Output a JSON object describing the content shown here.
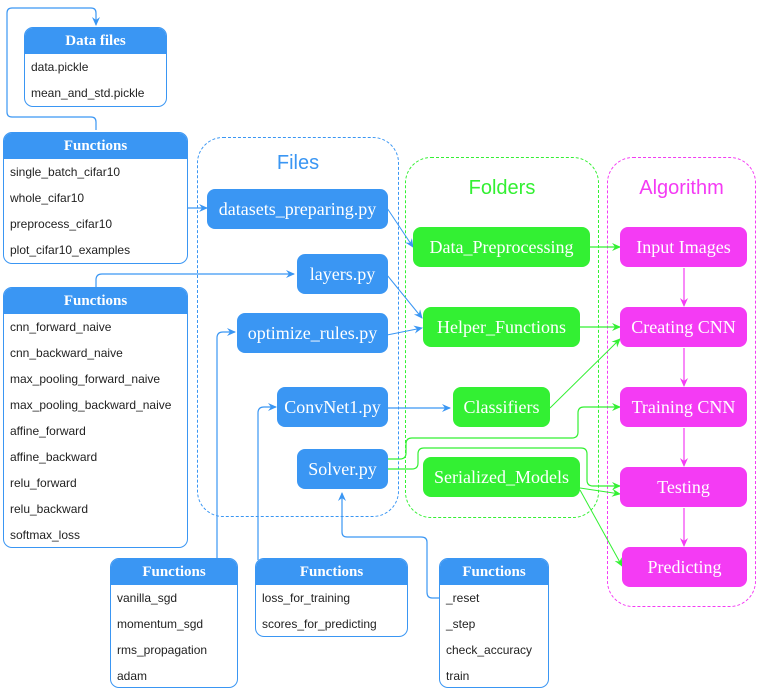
{
  "colors": {
    "files_blue": "#3a96f3",
    "folders_green": "#33f033",
    "algorithm_pink": "#f43bf4"
  },
  "data_files": {
    "title": "Data files",
    "items": [
      "data.pickle",
      "mean_and_std.pickle"
    ]
  },
  "functions_preparing": {
    "title": "Functions",
    "items": [
      "single_batch_cifar10",
      "whole_cifar10",
      "preprocess_cifar10",
      "plot_cifar10_examples"
    ]
  },
  "functions_layers": {
    "title": "Functions",
    "items": [
      "cnn_forward_naive",
      "cnn_backward_naive",
      "max_pooling_forward_naive",
      "max_pooling_backward_naive",
      "affine_forward",
      "affine_backward",
      "relu_forward",
      "relu_backward",
      "softmax_loss"
    ]
  },
  "functions_optimize": {
    "title": "Functions",
    "items": [
      "vanilla_sgd",
      "momentum_sgd",
      "rms_propagation",
      "adam"
    ]
  },
  "functions_convnet": {
    "title": "Functions",
    "items": [
      "loss_for_training",
      "scores_for_predicting"
    ]
  },
  "functions_solver": {
    "title": "Functions",
    "items": [
      "_reset",
      "_step",
      "check_accuracy",
      "train"
    ]
  },
  "files": {
    "title": "Files",
    "nodes": [
      "datasets_preparing.py",
      "layers.py",
      "optimize_rules.py",
      "ConvNet1.py",
      "Solver.py"
    ]
  },
  "folders": {
    "title": "Folders",
    "nodes": [
      "Data_Preprocessing",
      "Helper_Functions",
      "Classifiers",
      "Serialized_Models"
    ]
  },
  "algorithm": {
    "title": "Algorithm",
    "nodes": [
      "Input Images",
      "Creating CNN",
      "Training CNN",
      "Testing",
      "Predicting"
    ]
  }
}
